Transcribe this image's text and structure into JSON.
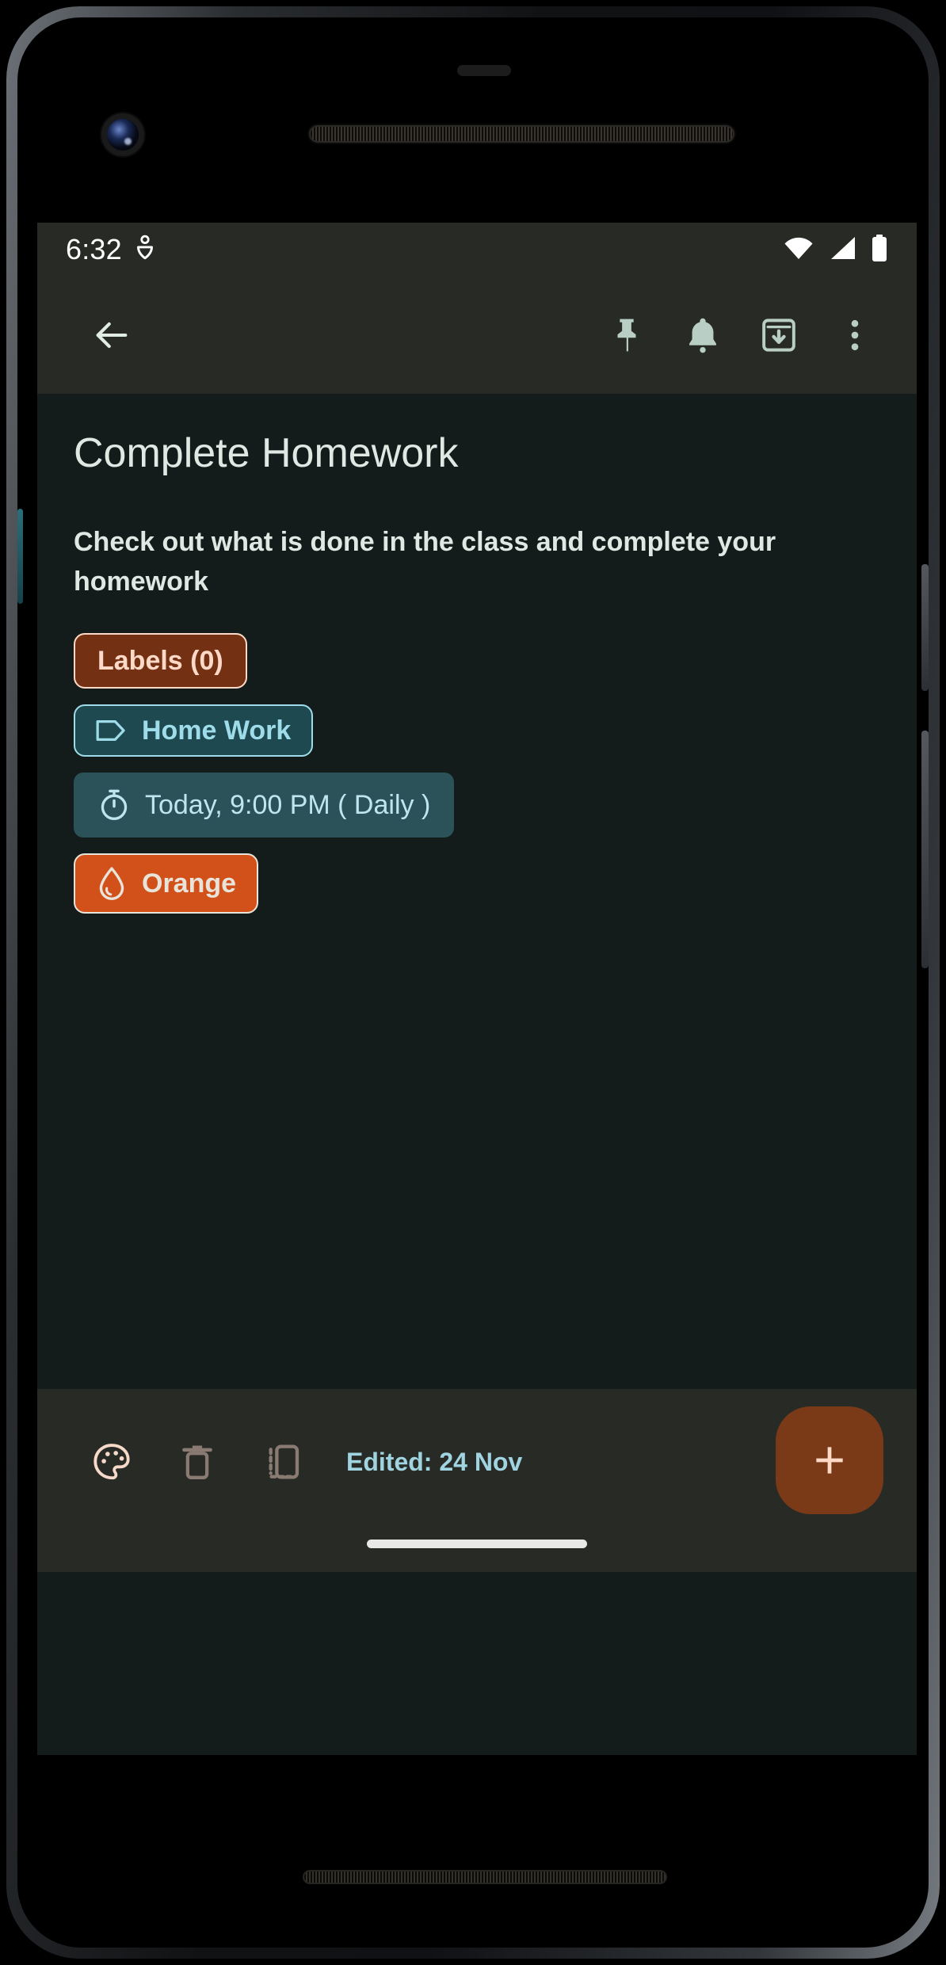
{
  "status_bar": {
    "time": "6:32",
    "left_icons": [
      "location-pin-icon"
    ],
    "right_icons": [
      "wifi-icon",
      "cellular-signal-icon",
      "battery-icon"
    ]
  },
  "app_bar": {
    "back_label": "back-arrow",
    "actions": [
      {
        "name": "pin",
        "label": "Pin"
      },
      {
        "name": "reminder",
        "label": "Reminder"
      },
      {
        "name": "archive",
        "label": "Archive"
      },
      {
        "name": "more",
        "label": "More options"
      }
    ]
  },
  "note": {
    "title": "Complete Homework",
    "body": "Check out what is done in the class and complete your homework",
    "chips": {
      "labels": {
        "text": "Labels (0)",
        "bg": "#733013",
        "fg": "#ffd9c7"
      },
      "label_tag": {
        "text": "Home Work",
        "bg": "#1f4950",
        "fg": "#9fdcea"
      },
      "reminder": {
        "text": "Today, 9:00 PM ( Daily )",
        "bg": "#2a5258",
        "fg": "#bfe6ef"
      },
      "color": {
        "text": "Orange",
        "bg": "#d2501a",
        "fg": "#e8e4da"
      }
    }
  },
  "bottom_bar": {
    "actions": [
      {
        "name": "palette",
        "label": "Change color"
      },
      {
        "name": "delete",
        "label": "Delete"
      },
      {
        "name": "copy",
        "label": "Make a copy"
      }
    ],
    "edited": "Edited: 24 Nov",
    "fab_label": "+"
  },
  "theme": {
    "content_bg": "#131c1b",
    "bar_bg": "#282a26",
    "accent_orange": "#d2501a",
    "accent_brown": "#7a3a17",
    "accent_teal": "#9fdcea",
    "text_primary": "#dfe8e2"
  }
}
